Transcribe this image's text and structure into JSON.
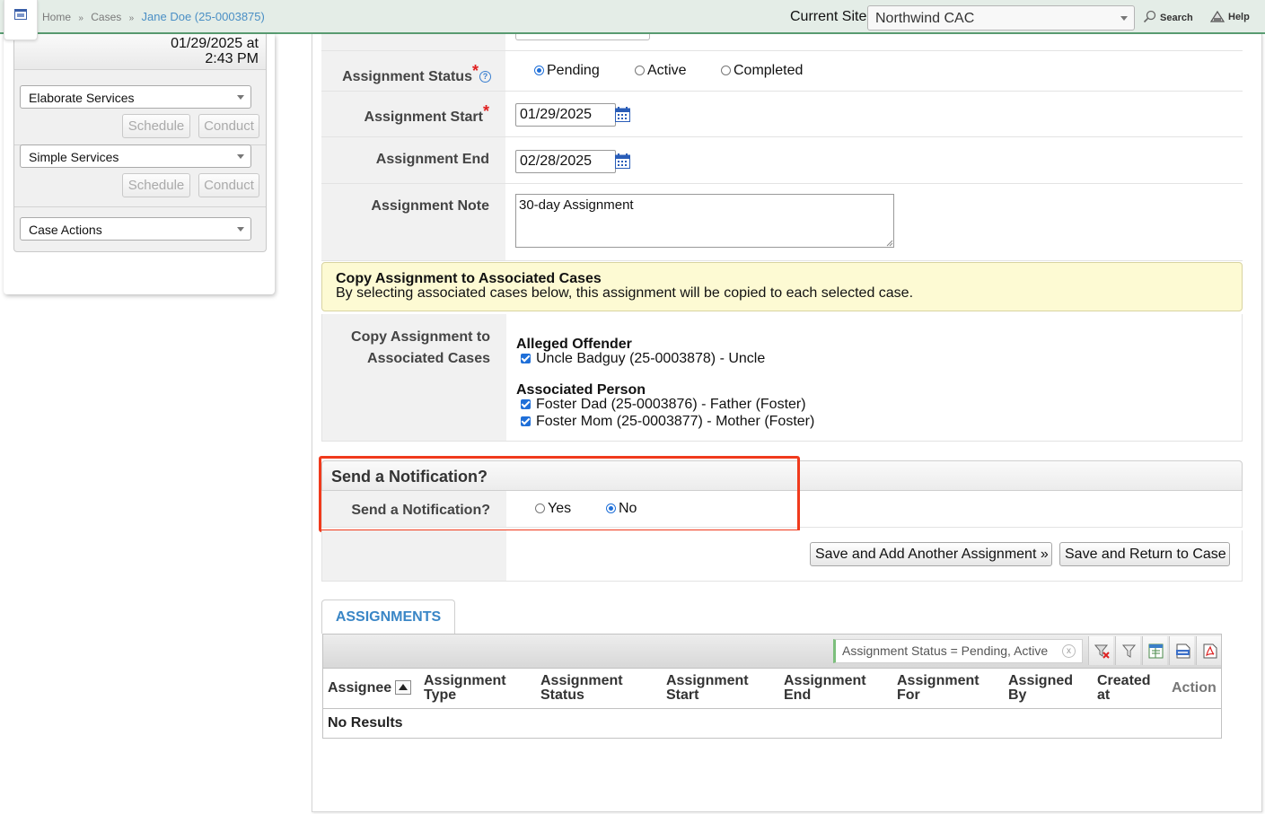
{
  "breadcrumb": {
    "home": "Home",
    "cases": "Cases",
    "current": "Jane Doe (25-0003875)",
    "separator": "»"
  },
  "header": {
    "site_label": "Current Site",
    "site_value": "Northwind CAC",
    "search_label": "Search",
    "help_label": "Help"
  },
  "left_panel": {
    "date_line1": "01/29/2025 at",
    "date_line2": "2:43 PM",
    "elaborate_select": "Elaborate Services",
    "simple_select": "Simple Services",
    "case_actions_select": "Case Actions",
    "schedule_label": "Schedule",
    "conduct_label": "Conduct"
  },
  "form": {
    "status_label": "Assignment Status",
    "status_options": [
      "Pending",
      "Active",
      "Completed"
    ],
    "status_selected": "Pending",
    "start_label": "Assignment Start",
    "start_value": "01/29/2025",
    "end_label": "Assignment End",
    "end_value": "02/28/2025",
    "note_label": "Assignment Note",
    "note_value": "30-day Assignment",
    "help_glyph": "?",
    "required_mark": "*"
  },
  "copy_notice": {
    "title": "Copy Assignment to Associated Cases",
    "body": "By selecting associated cases below, this assignment will be copied to each selected case."
  },
  "copy_section": {
    "label_line1": "Copy Assignment to",
    "label_line2": "Associated Cases",
    "offender_heading": "Alleged Offender",
    "offender_items": [
      "Uncle Badguy (25-0003878) - Uncle"
    ],
    "associated_heading": "Associated Person",
    "associated_items": [
      "Foster Dad (25-0003876) - Father (Foster)",
      "Foster Mom (25-0003877) - Mother (Foster)"
    ]
  },
  "notification": {
    "section_title": "Send a Notification?",
    "field_label": "Send a Notification?",
    "options": [
      "Yes",
      "No"
    ],
    "selected": "No"
  },
  "actions": {
    "save_add": "Save and Add Another Assignment »",
    "save_return": "Save and Return to Case"
  },
  "grid": {
    "tab_label": "ASSIGNMENTS",
    "filter_text": "Assignment Status = Pending, Active",
    "filter_clear": "x",
    "columns": [
      [
        "Assignee",
        ""
      ],
      [
        "Assignment",
        "Type"
      ],
      [
        "Assignment",
        "Status"
      ],
      [
        "Assignment",
        "Start"
      ],
      [
        "Assignment",
        "End"
      ],
      [
        "Assignment",
        "For"
      ],
      [
        "Assigned",
        "By"
      ],
      [
        "Created",
        "at"
      ],
      [
        "Action",
        ""
      ]
    ],
    "empty_text": "No Results",
    "tool_icons": [
      "clear-filters-icon",
      "filter-icon",
      "excel-export-icon",
      "csv-export-icon",
      "pdf-export-icon"
    ]
  },
  "colors": {
    "accent": "#5a9e72",
    "link": "#3a86c6",
    "highlight": "#f03a1c",
    "notice_bg": "#fdfad3"
  }
}
